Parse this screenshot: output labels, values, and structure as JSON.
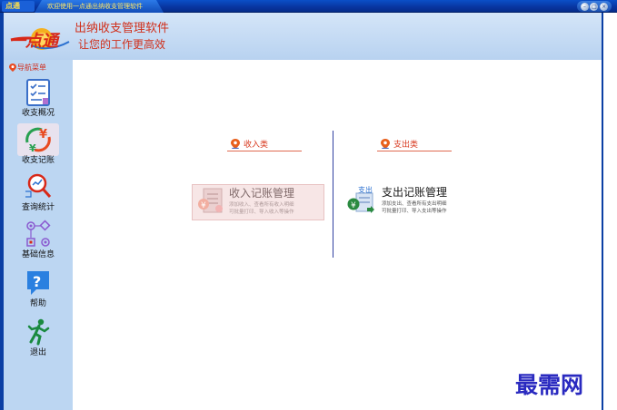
{
  "window": {
    "logo_text": "点通",
    "title": "欢迎使用一点通出纳收支管理软件",
    "buttons": [
      "minimize",
      "maximize",
      "close"
    ]
  },
  "header": {
    "brand": "一点通",
    "app_title": "出纳收支管理软件",
    "app_subtitle": "让您的工作更高效"
  },
  "sidebar": {
    "menu_label": "导航菜单",
    "items": [
      {
        "label": "收支概况",
        "icon": "checklist-icon"
      },
      {
        "label": "收支记账",
        "icon": "yuan-cycle-icon"
      },
      {
        "label": "查询统计",
        "icon": "magnifier-chart-icon"
      },
      {
        "label": "基础信息",
        "icon": "flowchart-icon"
      },
      {
        "label": "帮助",
        "icon": "help-icon"
      },
      {
        "label": "退出",
        "icon": "running-man-icon"
      }
    ]
  },
  "main": {
    "income": {
      "section": "收入类",
      "card_title": "收入记账管理",
      "desc_line1": "添加收入、查看所有收入明细",
      "desc_line2": "可批量打印、导入收入等操作"
    },
    "expense": {
      "section": "支出类",
      "icon_text": "支出",
      "card_title": "支出记账管理",
      "desc_line1": "添加支出、查看所有支出明细",
      "desc_line2": "可批量打印、导入支出等操作"
    }
  },
  "watermark": "最需网",
  "colors": {
    "titlebar": "#0835a0",
    "header_bg": "#c8dcf4",
    "sidebar_bg": "#bcd6f2",
    "accent_red": "#d0301c",
    "divider": "#3040a0",
    "watermark": "#2a2ac0"
  }
}
